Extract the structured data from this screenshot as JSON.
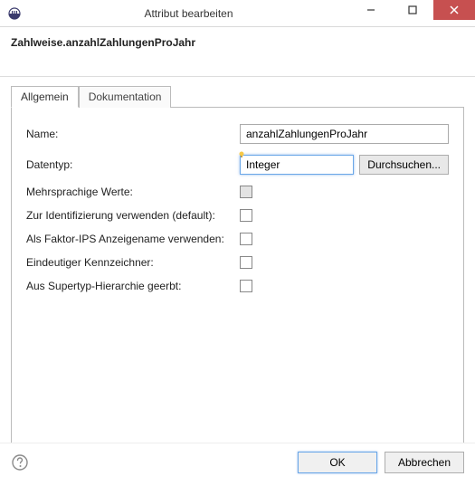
{
  "window": {
    "title": "Attribut bearbeiten"
  },
  "header": {
    "title": "Zahlweise.anzahlZahlungenProJahr"
  },
  "tabs": {
    "items": [
      {
        "label": "Allgemein",
        "active": true
      },
      {
        "label": "Dokumentation",
        "active": false
      }
    ]
  },
  "form": {
    "name_label": "Name:",
    "name_value": "anzahlZahlungenProJahr",
    "datatype_label": "Datentyp:",
    "datatype_value": "Integer",
    "browse_label": "Durchsuchen...",
    "multilingual_label": "Mehrsprachige Werte:",
    "identify_label": "Zur Identifizierung verwenden (default):",
    "displayname_label": "Als Faktor-IPS Anzeigename verwenden:",
    "unique_label": "Eindeutiger Kennzeichner:",
    "inherited_label": "Aus Supertyp-Hierarchie geerbt:"
  },
  "buttons": {
    "ok": "OK",
    "cancel": "Abbrechen"
  }
}
